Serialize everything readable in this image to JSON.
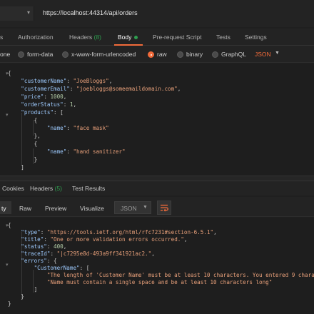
{
  "url_bar": {
    "url": "https://localhost:44314/api/orders"
  },
  "request_tabs": [
    {
      "label": "s"
    },
    {
      "label": "Authorization"
    },
    {
      "label": "Headers",
      "count": "(8)"
    },
    {
      "label": "Body"
    },
    {
      "label": "Pre-request Script"
    },
    {
      "label": "Tests"
    },
    {
      "label": "Settings"
    }
  ],
  "body_types": [
    {
      "label": "one"
    },
    {
      "label": "form-data"
    },
    {
      "label": "x-www-form-urlencoded"
    },
    {
      "label": "raw"
    },
    {
      "label": "binary"
    },
    {
      "label": "GraphQL"
    }
  ],
  "body_format": "JSON",
  "request_body_lines": [
    "{",
    "    \"customerName\": \"JoeBloggs\",",
    "    \"customerEmail\": \"joebloggs@someemaildomain.com\",",
    "    \"price\": 1000,",
    "    \"orderStatus\": 1,",
    "    \"products\": [",
    "        {",
    "            \"name\": \"face mask\"",
    "        },",
    "        {",
    "            \"name\": \"hand sanitizer\"",
    "        }",
    "    ]"
  ],
  "response_tabs": [
    {
      "label": "Cookies"
    },
    {
      "label": "Headers",
      "count": "(5)"
    },
    {
      "label": "Test Results"
    }
  ],
  "response_view_tabs": [
    {
      "label": "ty"
    },
    {
      "label": "Raw"
    },
    {
      "label": "Preview"
    },
    {
      "label": "Visualize"
    }
  ],
  "response_format": "JSON",
  "response_body_lines": [
    "{",
    "    \"type\": \"https://tools.ietf.org/html/rfc7231#section-6.5.1\",",
    "    \"title\": \"One or more validation errors occurred.\",",
    "    \"status\": 400,",
    "    \"traceId\": \"|c7295e8d-493a9ff341921ac2.\",",
    "    \"errors\": {",
    "        \"CustomerName\": [",
    "            \"The length of 'Customer Name' must be at least 10 characters. You entered 9 characters.\",",
    "            \"Name must contain a single space and be at least 10 characters long\"",
    "        ]",
    "    }",
    "}"
  ],
  "colors": {
    "accent": "#f26b3a",
    "green": "#2e9e4f",
    "json_key": "#9ecbff",
    "json_string": "#e8a07a",
    "json_number": "#b5cea8"
  },
  "icons": [
    "chevron-down-icon",
    "radio-icon",
    "wrap-lines-icon",
    "fold-chevron-icon"
  ]
}
